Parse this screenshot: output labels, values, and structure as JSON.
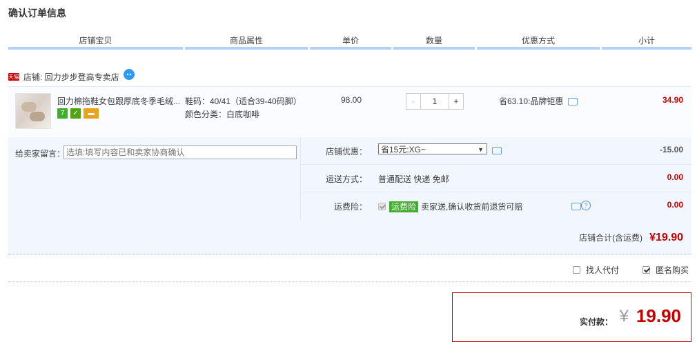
{
  "page": {
    "title": "确认订单信息"
  },
  "header": {
    "columns": [
      "店铺宝贝",
      "商品属性",
      "单价",
      "数量",
      "优惠方式",
      "小计"
    ]
  },
  "shop": {
    "badge": "天猫",
    "label": "店铺: 回力步步登高专卖店",
    "chat_icon": "wangwang-icon"
  },
  "item": {
    "name": "回力棉拖鞋女包跟厚底冬季毛绒...",
    "badges": [
      {
        "text": "7",
        "icon": "7day-return-icon"
      },
      {
        "text": "✓",
        "icon": "guarantee-icon"
      },
      {
        "text": "▬",
        "icon": "card-icon"
      }
    ],
    "attr_size": "鞋码：40/41（适合39-40码脚）",
    "attr_color": "颜色分类：白底咖啡",
    "unit_price": "98.00",
    "quantity": "1",
    "qty_minus": "-",
    "qty_plus": "+",
    "discount": "省63.10:品牌钜惠",
    "subtotal": "34.90"
  },
  "message": {
    "label": "给卖家留言：",
    "placeholder": "选填:填写内容已和卖家协商确认"
  },
  "shop_discount": {
    "label": "店铺优惠：",
    "selected": "省15元:XG~",
    "amount": "-15.00"
  },
  "shipping": {
    "label": "运送方式：",
    "value": "普通配送 快递 免邮",
    "amount": "0.00"
  },
  "insurance": {
    "label": "运费险：",
    "tag": "运费险",
    "text": "卖家送,确认收货前退货可赔",
    "amount": "0.00"
  },
  "shop_total": {
    "label": "店铺合计(含运费)",
    "value": "¥19.90"
  },
  "options": {
    "proxy_label": "找人代付",
    "proxy_checked": false,
    "anon_label": "匿名购买",
    "anon_checked": true
  },
  "payment": {
    "label": "实付款：",
    "symbol": "¥",
    "value": "19.90"
  },
  "colors": {
    "accent_red": "#c40000",
    "header_bar": "#b2d1ff",
    "panel_bg": "#f2f7ff",
    "green": "#3fae2a"
  }
}
